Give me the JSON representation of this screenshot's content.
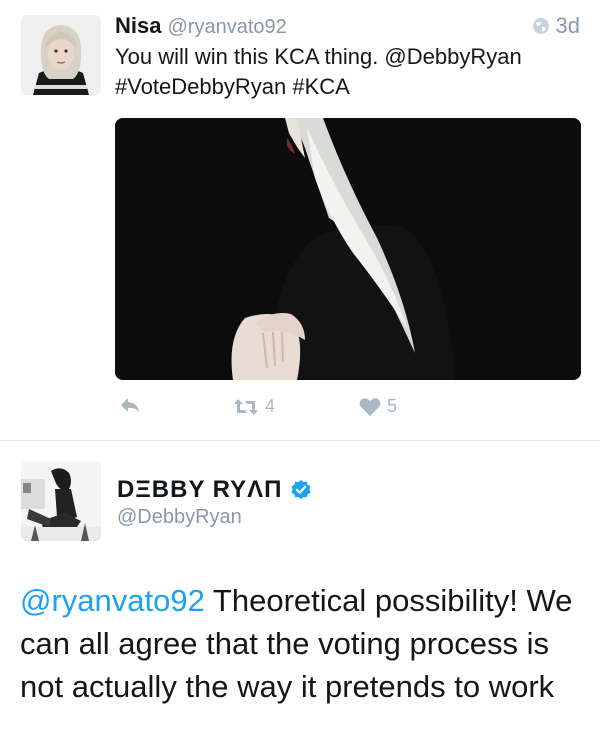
{
  "tweet1": {
    "name": "Nisa",
    "handle": "@ryanvato92",
    "time": "3d",
    "text_line1": "You will win this KCA thing. @DebbyRyan",
    "text_line2": "#VoteDebbyRyan #KCA",
    "retweet_count": "4",
    "like_count": "5",
    "icons": [
      "globe-icon",
      "reply-icon",
      "retweet-icon",
      "heart-icon"
    ]
  },
  "tweet2": {
    "name": "DΞBBY RYΛΠ",
    "handle": "@DebbyRyan",
    "mention": "@ryanvato92",
    "text": " Theoretical possibility! We can all agree that the voting process is not actually the way it pretends to work",
    "icons": [
      "verified-badge-icon"
    ]
  },
  "colors": {
    "link": "#1da1f2",
    "muted": "#8899a6",
    "action": "#aab8c2",
    "divider": "#e1e8ed"
  }
}
